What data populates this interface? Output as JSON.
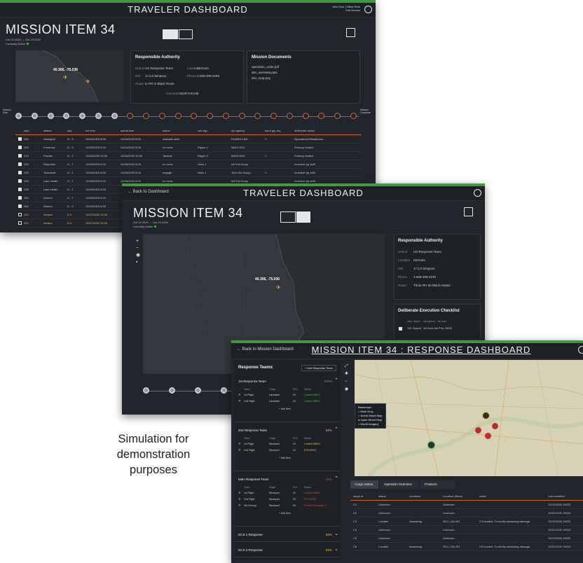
{
  "caption": [
    "Simulation for",
    "demonstration",
    "purposes"
  ],
  "screen1": {
    "title": "TRAVELER DASHBOARD",
    "user": [
      "John Doe | Office Role",
      "Sub Access"
    ],
    "mission": "MISSION ITEM 34",
    "dates": "Oct 23 2020  →  Oct 29 2020",
    "status": "Currently Active",
    "map_coord": "40.306, -75.036",
    "authority": {
      "title": "Responsible Authority",
      "rows": [
        {
          "k": "Unit Id",
          "v": "US Response Team"
        },
        {
          "k": "OIC",
          "v": "1t Col Simpson"
        },
        {
          "k": "Route",
          "v": "to PR m Black Route"
        }
      ],
      "rows2": [
        {
          "k": "Location",
          "v": "McGuire"
        },
        {
          "k": "Phone",
          "v": "1-609-209-2230"
        }
      ],
      "command_label": "command",
      "command": "NORTHCOM"
    },
    "docs": {
      "title": "Mission Documents",
      "items": [
        "operation_order.pdf",
        "site_overview.pptx",
        "site_map.png"
      ]
    },
    "timeline_start": "Mission Start",
    "timeline_end": "Mission Complete",
    "table_headers": [
      "step",
      "station",
      "day",
      "est time",
      "actual time",
      "action",
      "call sign",
      "opl agency",
      "input grp req",
      "deliberate action"
    ],
    "rows": [
      [
        "100",
        "Stockport",
        "D - 3",
        "10/24/2020 8:00",
        "10/24/2020 8:00",
        "maintain alert",
        "",
        "PLAIDS LNO",
        "Y",
        "Operational Readiness"
      ],
      [
        "200",
        "Frederick",
        "D - 3",
        "10/24/2020 8:00",
        "10/24/2020 8:00",
        "on route",
        "Ripper 1",
        "MIDS NOC",
        "",
        "Primary Holdco"
      ],
      [
        "210",
        "Powder",
        "D - 2",
        "10/24/2020 12:00",
        "10/24/2020 12:00",
        "Tactical",
        "Ripper 2",
        "MIDS NOC",
        "Y",
        "Primary Holdco"
      ],
      [
        "220",
        "Reynolds",
        "D - 1",
        "10/25/2020 8:00",
        "10/25/2020 8:00",
        "en route",
        "Hello 1",
        "Int'l Ed Group",
        "",
        "Accident (a) shift"
      ],
      [
        "225",
        "Townwide",
        "D - 1",
        "10/25/2020 8:00",
        "10/25/2020 8:00",
        "engage",
        "Hello 1",
        "Tech Div Group",
        "Y",
        "Accident (a) shift"
      ],
      [
        "230",
        "Lake Heath",
        "D - 1",
        "10/25/2020 8:00",
        "10/25/2020 8:00",
        "en route",
        "",
        "Int'l Ed Group",
        "",
        "Accident (a) shift"
      ],
      [
        "235",
        "Lake Heath",
        "D - 1",
        "10/25/2020 8:00",
        "",
        "",
        "",
        "",
        "",
        ""
      ],
      [
        "250",
        "Athens",
        "D - 1",
        "10/25/2020 8:00",
        "",
        "",
        "",
        "",
        "",
        ""
      ],
      [
        "260",
        "Athens",
        "D - 0",
        "10/26/2020 8:00",
        "",
        "",
        "",
        "",
        "",
        ""
      ],
      [
        "310",
        "Arvane",
        "D 0",
        "10/27/2020 12:00",
        "",
        "",
        "",
        "",
        "",
        ""
      ],
      [
        "320",
        "Arvane",
        "D 0",
        "10/27/2020 12:00",
        "",
        "",
        "",
        "",
        "",
        ""
      ]
    ]
  },
  "screen2": {
    "back": "Back to Dashboard",
    "title": "TRAVELER DASHBOARD",
    "mission": "MISSION ITEM 34",
    "dates": "Oct 23 2020  →  Oct 23 2020",
    "status": "Currently Active",
    "map_coord": "40.306, -75.036",
    "authority": {
      "title": "Responsible Authority",
      "rows": [
        {
          "k": "Unit Id",
          "v": "US Response Team"
        },
        {
          "k": "Location",
          "v": "McGuire"
        },
        {
          "k": "OIC",
          "v": "1t Col Simpson"
        },
        {
          "k": "Phone",
          "v": "1-609-209-2230"
        },
        {
          "k": "Route",
          "v": "Three RH 60 Black Hawks"
        }
      ]
    },
    "checklist": {
      "title": "Deliberate Execution Checklist",
      "headers": [
        "step",
        "station",
        "opl agency",
        "est time"
      ],
      "row": [
        "105",
        "Support",
        "3rd Dock Unit Prep",
        "8/8/20"
      ]
    }
  },
  "screen3": {
    "back": "Back to Mission Dashboard",
    "title": "MISSION ITEM 34 : RESPONSE DASHBOARD",
    "panel_title": "Response Teams",
    "add_button": "+ Add Response Team",
    "teams": [
      {
        "name": "1st Response Team",
        "pct": "100%",
        "color": "#45c04a",
        "rows": [
          [
            "1st Flight",
            "Lancaster",
            "20",
            "Loaded 0800Z"
          ],
          [
            "2nd Flight",
            "Lancaster",
            "20",
            "Loaded 0800Z"
          ]
        ]
      },
      {
        "name": "2nd Response Team",
        "pct": "50%",
        "color": "#f0c23a",
        "rows": [
          [
            "1st Flight",
            "Stockport",
            "20",
            "Loaded 0800Z"
          ],
          [
            "2nd Flight",
            "Stockport",
            "20",
            "ETA 0900Z"
          ]
        ]
      },
      {
        "name": "Main Response Team",
        "pct": "25%",
        "color": "#e0483c",
        "rows": [
          [
            "1st Flight",
            "Stockport",
            "20",
            "Loaded 0800Z"
          ],
          [
            "2nd Flight",
            "Stockport",
            "20",
            "ETA 0900Z"
          ],
          [
            "3rd Convoy",
            "Stockport",
            "90",
            "Fueled Checkpoint 2"
          ]
        ]
      },
      {
        "name": "DCS 1 Response",
        "pct": "50%",
        "color": "#f0c23a",
        "rows": []
      },
      {
        "name": "DCS 2 Response",
        "pct": "50%",
        "color": "#f0c23a",
        "rows": []
      }
    ],
    "team_headers": [
      "Team",
      "Origin",
      "PAX",
      "Status"
    ],
    "add_item": "+ Add Item",
    "layers": [
      "Basemaps",
      "Dark Gray",
      "World Street Map",
      "Open Street Map",
      "World Imagery"
    ],
    "tabs": [
      "Cargo Status",
      "Operation Overview",
      "Products"
    ],
    "cargo_headers": [
      "cargo id",
      "status",
      "condition",
      "Location (Base)",
      "notes",
      "Last modified"
    ],
    "cargo_rows": [
      [
        "C1",
        "Unknown",
        "",
        "Unknown",
        "",
        "12/31/2020 1902Z"
      ],
      [
        "C2",
        "Unknown",
        "",
        "Unknown",
        "",
        "12/31/2020 1902Z"
      ],
      [
        "C3",
        "Located",
        "Assessing",
        "38.0,-118.491",
        "C3 located. Currently assessing damage.",
        "12/31/2020 1902Z"
      ],
      [
        "C4",
        "Unknown",
        "",
        "Unknown",
        "",
        "12/31/2020 1902Z"
      ],
      [
        "C5",
        "Unknown",
        "",
        "Unknown",
        "",
        "12/31/2020 1902Z"
      ],
      [
        "C6",
        "Located",
        "Assessing",
        "38.0,-118.491",
        "C6 located. Currently assessing damage.",
        "12/31/2020 1902Z"
      ]
    ]
  }
}
